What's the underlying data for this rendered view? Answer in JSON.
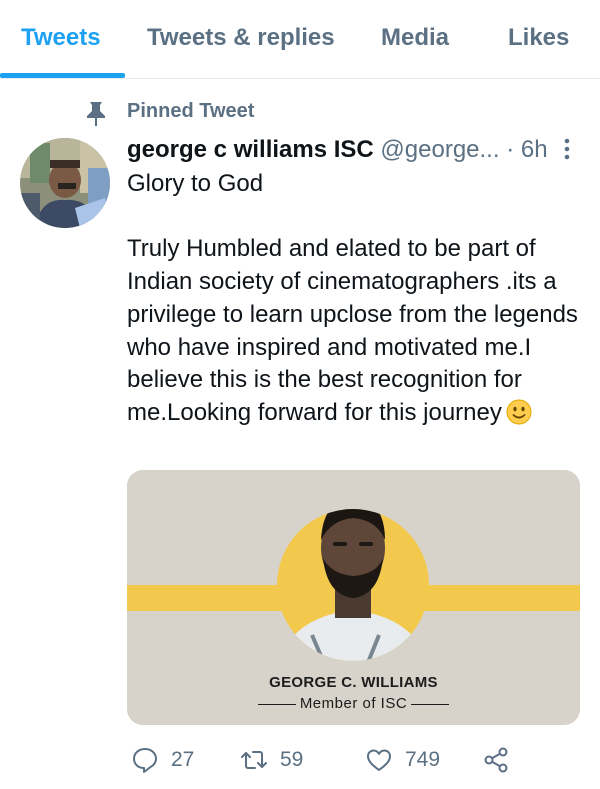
{
  "tabs": [
    {
      "label": "Tweets",
      "active": true
    },
    {
      "label": "Tweets & replies",
      "active": false
    },
    {
      "label": "Media",
      "active": false
    },
    {
      "label": "Likes",
      "active": false
    }
  ],
  "pinned": {
    "label": "Pinned Tweet",
    "icon": "pin-icon"
  },
  "tweet": {
    "author_name": "george c williams ISC",
    "author_handle": "@george...",
    "separator": "·",
    "time": "6h",
    "text": "Glory to God\n\nTruly Humbled and elated to be part of Indian society of cinematographers .its a privilege to learn upclose from the legends who have inspired and motivated me.I believe this is the best recognition for me.Looking forward for this journey",
    "emoji": "slightly-smiling-face",
    "media": {
      "name": "GEORGE C. WILLIAMS",
      "subtitle": "Member of ISC",
      "accent_color": "#f2c94c"
    },
    "actions": {
      "reply_count": "27",
      "retweet_count": "59",
      "like_count": "749"
    }
  },
  "colors": {
    "accent": "#1da1f2",
    "secondary_text": "#5b7083",
    "primary_text": "#0f1419"
  }
}
